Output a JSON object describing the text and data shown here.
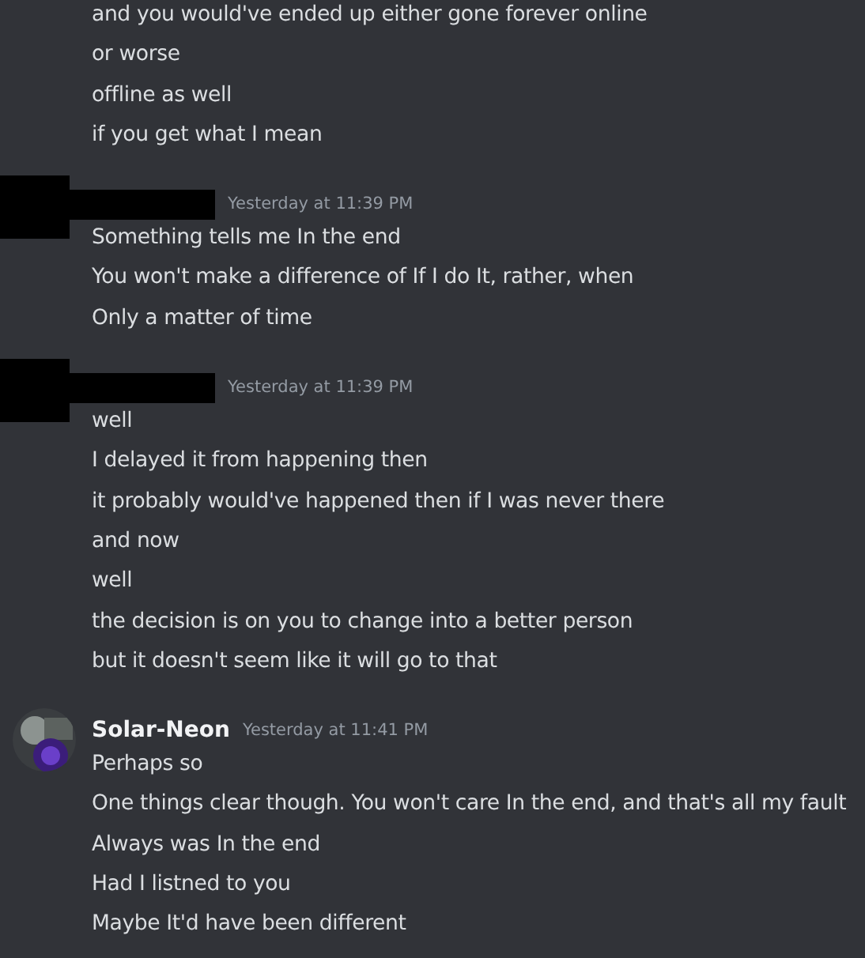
{
  "messages": [
    {
      "lines": [
        "and you would've ended up either gone forever online",
        "or worse",
        "offline as well",
        "if you get what I mean"
      ]
    },
    {
      "redacted": true,
      "timestamp": "Yesterday at 11:39 PM",
      "lines": [
        "Something tells me In the end",
        "You won't make a difference of If I do It, rather, when",
        "Only a matter of time"
      ]
    },
    {
      "redacted": true,
      "timestamp": "Yesterday at 11:39 PM",
      "lines": [
        "well",
        "I delayed it from happening then",
        "it probably would've happened then if I was never there",
        "and now",
        "well",
        "the decision is on you to change into a better person",
        "but it doesn't seem like it will go to that"
      ]
    },
    {
      "redacted": false,
      "author": "Solar-Neon",
      "timestamp": "Yesterday at 11:41 PM",
      "lines": [
        "Perhaps so",
        "One things clear though. You won't care In the end, and that's all my fault",
        "Always was In the end",
        "Had I listned to you",
        "Maybe It'd have been different"
      ]
    }
  ]
}
